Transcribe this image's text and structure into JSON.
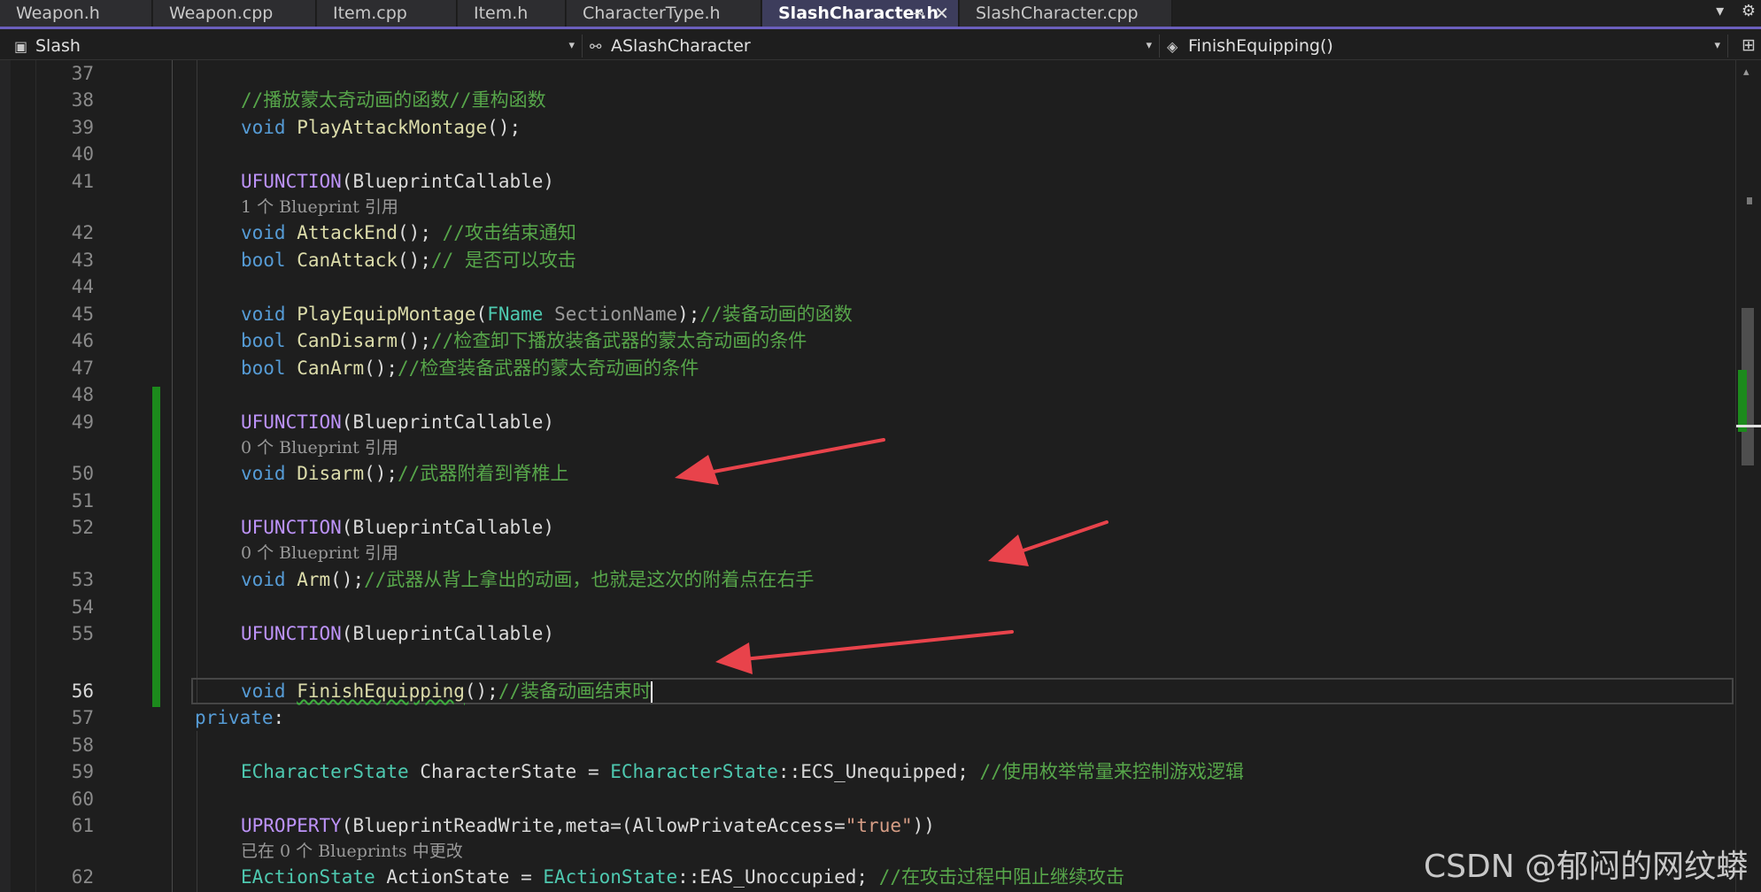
{
  "tabs": [
    {
      "label": "Weapon.h"
    },
    {
      "label": "Weapon.cpp"
    },
    {
      "label": "Item.cpp"
    },
    {
      "label": "Item.h"
    },
    {
      "label": "CharacterType.h"
    },
    {
      "label": "SlashCharacter.h",
      "active": true,
      "pin_icon": "⊸",
      "close_icon": "✕"
    },
    {
      "label": "SlashCharacter.cpp"
    }
  ],
  "tabbar_tools": {
    "dropdown_icon": "▾",
    "settings_icon": "⚙"
  },
  "nav": {
    "project": "Slash",
    "class_scope": "ASlashCharacter",
    "member": "FinishEquipping()",
    "dropdown_icon": "▾",
    "split_icon": "⊞"
  },
  "editor": {
    "lines": [
      {
        "num": "37"
      },
      {
        "num": "38",
        "comment": "//播放蒙太奇动画的函数//重构函数"
      },
      {
        "num": "39",
        "kw": "void",
        "fn": "PlayAttackMontage",
        "rest": "();"
      },
      {
        "num": "40"
      },
      {
        "num": "41",
        "macro": "UFUNCTION",
        "args": "BlueprintCallable"
      },
      {
        "num": "",
        "hint": "1 个 Blueprint 引用"
      },
      {
        "num": "42",
        "kw": "void",
        "fn": "AttackEnd",
        "rest": "(); ",
        "comment": "//攻击结束通知"
      },
      {
        "num": "43",
        "kw": "bool",
        "fn": "CanAttack",
        "rest": "();",
        "comment": "// 是否可以攻击"
      },
      {
        "num": "44"
      },
      {
        "num": "45",
        "kw": "void",
        "fn": "PlayEquipMontage",
        "paramtype": "FName",
        "param": "SectionName",
        "rest": ");",
        "comment": "//装备动画的函数"
      },
      {
        "num": "46",
        "kw": "bool",
        "fn": "CanDisarm",
        "rest": "();",
        "comment": "//检查卸下播放装备武器的蒙太奇动画的条件"
      },
      {
        "num": "47",
        "kw": "bool",
        "fn": "CanArm",
        "rest": "();",
        "comment": "//检查装备武器的蒙太奇动画的条件"
      },
      {
        "num": "48"
      },
      {
        "num": "49",
        "macro": "UFUNCTION",
        "args": "BlueprintCallable"
      },
      {
        "num": "",
        "hint": "0 个 Blueprint 引用"
      },
      {
        "num": "50",
        "kw": "void",
        "fn": "Disarm",
        "rest": "();",
        "comment": "//武器附着到脊椎上"
      },
      {
        "num": "51"
      },
      {
        "num": "52",
        "macro": "UFUNCTION",
        "args": "BlueprintCallable"
      },
      {
        "num": "",
        "hint": "0 个 Blueprint 引用"
      },
      {
        "num": "53",
        "kw": "void",
        "fn": "Arm",
        "rest": "();",
        "comment": "//武器从背上拿出的动画，也就是这次的附着点在右手"
      },
      {
        "num": "54"
      },
      {
        "num": "55",
        "macro": "UFUNCTION",
        "args": "BlueprintCallable"
      },
      {
        "num": ""
      },
      {
        "num": "56",
        "kw": "void",
        "fn": "FinishEquipping",
        "rest": "();",
        "comment": "//装备动画结束时"
      },
      {
        "num": "57",
        "access": "private",
        "rest": ":"
      },
      {
        "num": "58"
      },
      {
        "num": "59",
        "type1": "ECharacterState",
        "ident": "CharacterState",
        "eq": " = ",
        "type2": "ECharacterState",
        "scope": "::",
        "enumval": "ECS_Unequipped",
        "rest": "; ",
        "comment": "//使用枚举常量来控制游戏逻辑"
      },
      {
        "num": "60"
      },
      {
        "num": "61",
        "macro": "UPROPERTY",
        "args1": "BlueprintReadWrite,",
        "meta": "meta",
        "args2": "=(AllowPrivateAccess=",
        "str": "\"true\"",
        "rest": "))"
      },
      {
        "num": "",
        "hint": "已在 0 个 Blueprints 中更改"
      },
      {
        "num": "62",
        "type1": "EActionState",
        "ident": "ActionState",
        "eq": " = ",
        "type2": "EActionState",
        "scope": "::",
        "enumval": "EAS_Unoccupied",
        "rest": "; ",
        "comment": "//在攻击过程中阻止继续攻击"
      }
    ]
  },
  "scrollbar": {
    "up_icon": "▴"
  },
  "watermark": "CSDN @郁闷的网纹蟒",
  "colors": {
    "keyword": "#569cd6",
    "function": "#dcdcaa",
    "type": "#4ec9b0",
    "comment": "#57a64a",
    "macro": "#bd93f9",
    "change_bar": "#1c8a1c",
    "arrow": "#e8434b",
    "active_tab_underline": "#6b5fbd"
  }
}
